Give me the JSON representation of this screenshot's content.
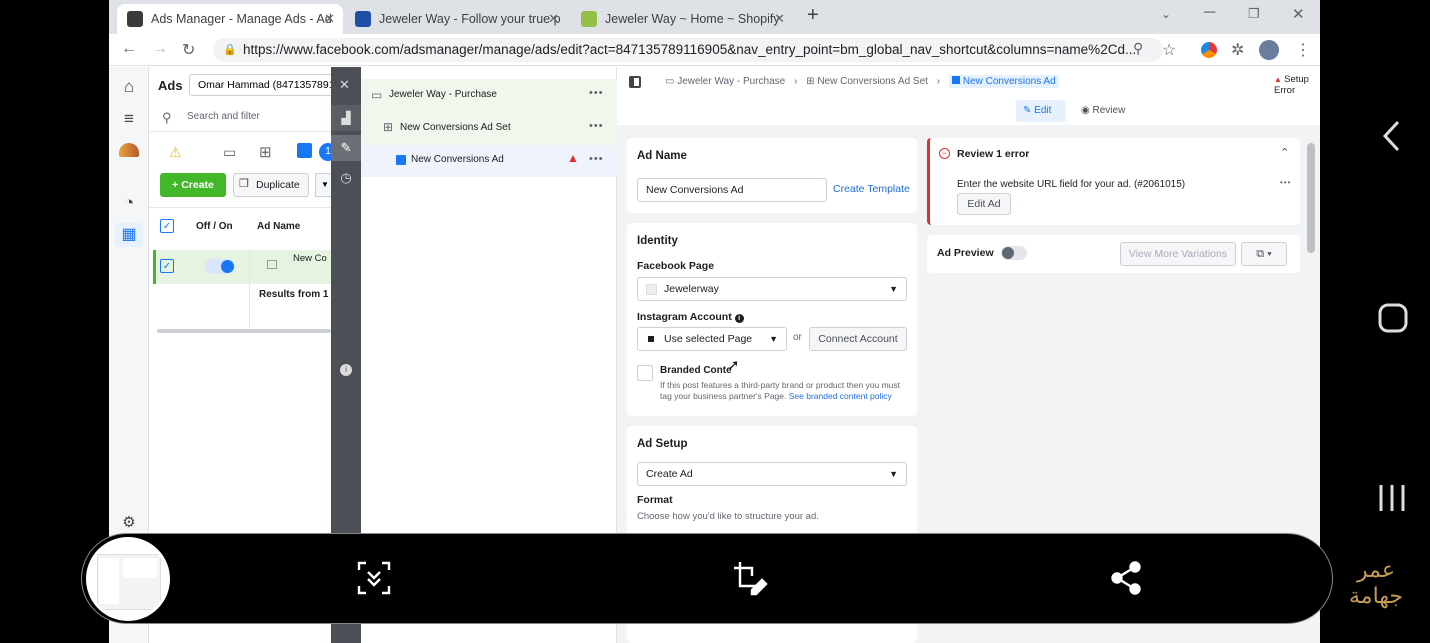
{
  "browser": {
    "tabs": [
      {
        "title": "Ads Manager - Manage Ads - Ad"
      },
      {
        "title": "Jeweler Way - Follow your true p"
      },
      {
        "title": "Jeweler Way ~ Home ~ Shopify"
      }
    ],
    "new_tab": "+",
    "url": "https://www.facebook.com/adsmanager/manage/ads/edit?act=847135789116905&nav_entry_point=bm_global_nav_shortcut&columns=name%2Cd..."
  },
  "ads_panel": {
    "title": "Ads",
    "account": "Omar Hammad (847135789116",
    "search_placeholder": "Search and filter",
    "create_label": "Create",
    "duplicate_label": "Duplicate",
    "badge": "1",
    "col_off_on": "Off / On",
    "col_ad_name": "Ad Name",
    "row_name": "New Co",
    "results": "Results from 1 a"
  },
  "tree": {
    "campaign": "Jeweler Way - Purchase",
    "adset": "New Conversions Ad Set",
    "ad": "New Conversions Ad"
  },
  "breadcrumb": {
    "campaign": "Jeweler Way - Purchase",
    "adset": "New Conversions Ad Set",
    "ad": "New Conversions Ad",
    "setup_error": "Setup Error"
  },
  "mode": {
    "edit": "Edit",
    "review": "Review"
  },
  "ad_name_section": {
    "title": "Ad Name",
    "value": "New Conversions Ad",
    "create_template": "Create Template"
  },
  "identity": {
    "title": "Identity",
    "facebook_page_label": "Facebook Page",
    "facebook_page_value": "Jewelerway",
    "instagram_label": "Instagram Account",
    "instagram_value": "Use selected Page",
    "or": "or",
    "connect_account": "Connect Account",
    "branded_title": "Branded Conte",
    "branded_desc_1": "If this post features a third-party brand or product then you must",
    "branded_desc_2": "tag your business partner's Page.",
    "branded_link": "See branded content policy"
  },
  "ad_setup": {
    "title": "Ad Setup",
    "value": "Create Ad",
    "format_label": "Format",
    "format_desc": "Choose how you'd like to structure your ad."
  },
  "review": {
    "title": "Review 1 error",
    "message": "Enter the website URL field for your ad. (#2061015)",
    "edit_ad": "Edit Ad"
  },
  "preview": {
    "title": "Ad Preview",
    "more_variations": "View More Variations"
  },
  "brand_text": {
    "line1": "عمر",
    "line2": "جهامة"
  },
  "colors": {
    "accent": "#1877f2",
    "create_green": "#42b72a",
    "error_red": "#e02f2f",
    "tree_selected": "#eef3fc"
  }
}
